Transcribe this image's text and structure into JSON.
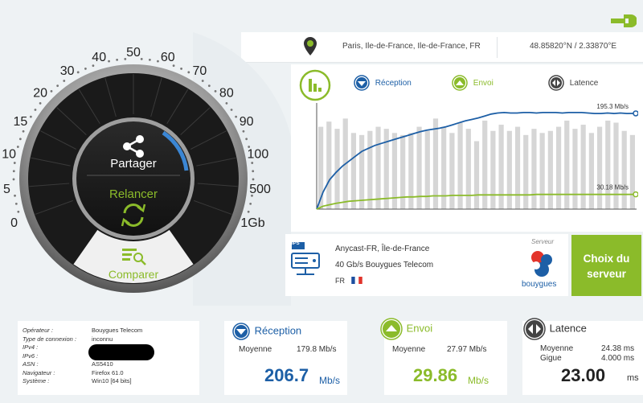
{
  "location": {
    "city": "Paris, Ile-de-France, Ile-de-France, FR",
    "coords": "48.85820°N / 2.33870°E"
  },
  "gauge": {
    "share_label": "Partager",
    "restart_label": "Relancer",
    "compare_label": "Comparer",
    "scale": [
      "0",
      "5",
      "10",
      "15",
      "20",
      "30",
      "40",
      "50",
      "60",
      "70",
      "80",
      "90",
      "100",
      "500",
      "1Gb"
    ]
  },
  "legend": {
    "download": "Réception",
    "upload": "Envoi",
    "latency": "Latence"
  },
  "chart_data": {
    "type": "line",
    "series": [
      {
        "name": "Réception",
        "color": "#1d5fa6",
        "end_label": "195.3 Mb/s",
        "values": [
          0,
          35,
          60,
          75,
          88,
          98,
          108,
          118,
          124,
          130,
          134,
          138,
          142,
          146,
          150,
          154,
          158,
          161,
          163,
          165,
          168,
          172,
          176,
          180,
          183,
          186,
          190,
          194,
          196,
          197,
          196,
          196,
          197,
          197,
          196,
          197,
          197,
          197,
          196,
          197,
          197,
          197,
          196,
          195,
          195,
          196,
          195,
          196,
          195,
          195.3
        ]
      },
      {
        "name": "Envoi",
        "color": "#8bbb2a",
        "end_label": "30.18 Mb/s",
        "values": [
          0,
          6,
          9,
          12,
          14,
          16,
          17,
          18,
          19,
          20,
          21,
          22,
          23,
          24,
          25,
          25,
          26,
          26,
          27,
          27,
          27,
          28,
          28,
          28,
          28,
          29,
          29,
          29,
          29,
          29,
          29,
          29,
          29,
          29,
          30,
          30,
          30,
          30,
          30,
          30,
          30,
          30,
          30,
          30,
          30,
          30,
          30,
          30,
          30,
          30.18
        ]
      }
    ],
    "bars": [
      80,
      85,
      78,
      88,
      74,
      72,
      76,
      80,
      78,
      74,
      72,
      74,
      80,
      76,
      88,
      80,
      74,
      84,
      78,
      66,
      86,
      76,
      82,
      76,
      80,
      72,
      78,
      74,
      76,
      80,
      86,
      78,
      82,
      74,
      80,
      86,
      84,
      76,
      72
    ],
    "ylim": [
      0,
      210
    ]
  },
  "server": {
    "badge": "IPS",
    "name": "Anycast-FR, Île-de-France",
    "capacity": "40 Gb/s Bouygues Telecom",
    "country": "FR",
    "server_label": "Serveur",
    "brand": "bouygues",
    "choose_label": "Choix du serveur"
  },
  "info": [
    {
      "k": "Opérateur :",
      "v": "Bouygues Telecom"
    },
    {
      "k": "Type de connexion :",
      "v": "inconnu"
    },
    {
      "k": "IPv4 :",
      "v": ""
    },
    {
      "k": "IPv6 :",
      "v": ""
    },
    {
      "k": "ASN :",
      "v": "AS5410"
    },
    {
      "k": "Navigateur :",
      "v": "Firefox 61.0"
    },
    {
      "k": "Système :",
      "v": "Win10 [64 bits]"
    }
  ],
  "results": {
    "download": {
      "title": "Réception",
      "avg_label": "Moyenne",
      "avg": "179.8 Mb/s",
      "value": "206.7",
      "unit": "Mb/s"
    },
    "upload": {
      "title": "Envoi",
      "avg_label": "Moyenne",
      "avg": "27.97 Mb/s",
      "value": "29.86",
      "unit": "Mb/s"
    },
    "latency": {
      "title": "Latence",
      "avg_label": "Moyenne",
      "avg": "24.38 ms",
      "jitter_label": "Gigue",
      "jitter": "4.000 ms",
      "value": "23.00",
      "unit": "ms"
    }
  },
  "colors": {
    "blue": "#1d5fa6",
    "green": "#8bbb2a",
    "dark": "#222222"
  }
}
